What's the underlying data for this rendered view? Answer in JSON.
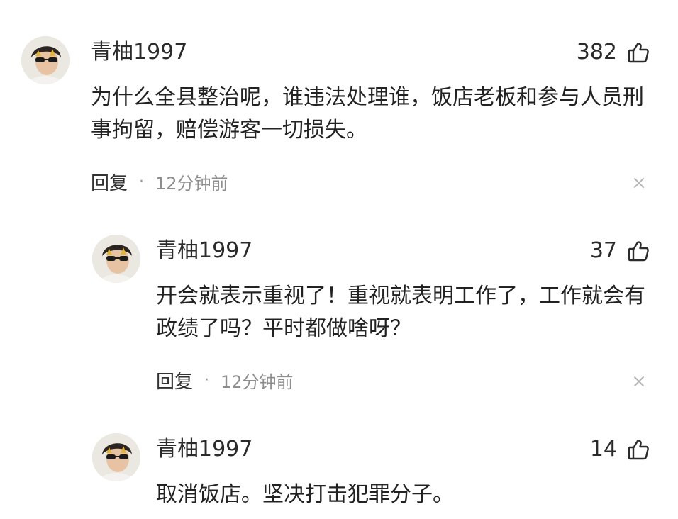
{
  "comments": [
    {
      "username": "青柚1997",
      "likes": "382",
      "text": "为什么全县整治呢，谁违法处理谁，饭店老板和参与人员刑事拘留，赔偿游客一切损失。",
      "reply_label": "回复",
      "separator": "·",
      "time": "12分钟前"
    },
    {
      "username": "青柚1997",
      "likes": "37",
      "text": "开会就表示重视了！重视就表明工作了，工作就会有政绩了吗？平时都做啥呀？",
      "reply_label": "回复",
      "separator": "·",
      "time": "12分钟前"
    },
    {
      "username": "青柚1997",
      "likes": "14",
      "text": "取消饭店。坚决打击犯罪分子。"
    }
  ],
  "icons": {
    "like": "thumbs-up-icon",
    "close": "close-icon"
  },
  "colors": {
    "text": "#222222",
    "muted": "#8e8e8e",
    "background": "#ffffff"
  }
}
